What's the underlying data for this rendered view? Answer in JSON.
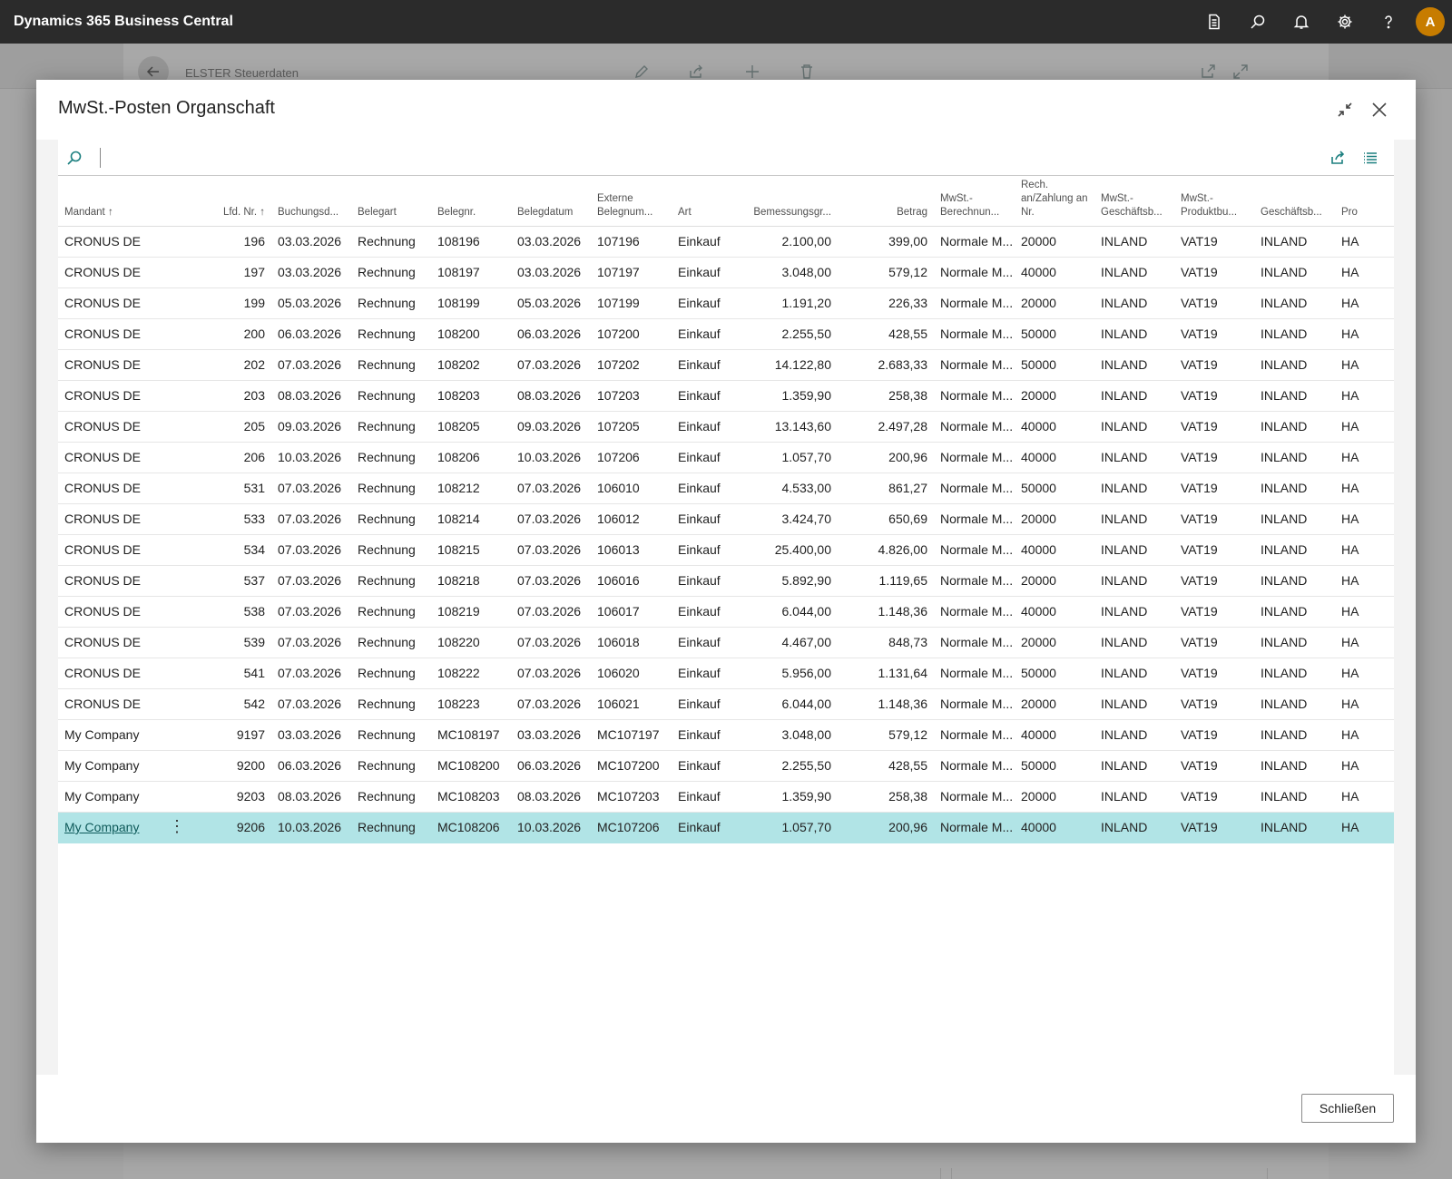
{
  "app": {
    "title": "Dynamics 365 Business Central",
    "avatar_initial": "A",
    "toolbar_icons": [
      "document-icon",
      "search-icon",
      "bell-icon",
      "gear-icon",
      "help-icon"
    ]
  },
  "background_page": {
    "title": "ELSTER Steuerdaten"
  },
  "dialog": {
    "title": "MwSt.-Posten Organschaft",
    "close_label": "Schließen",
    "columns": [
      {
        "key": "mandant",
        "label": "Mandant ↑"
      },
      {
        "key": "lfd",
        "label": "Lfd. Nr. ↑"
      },
      {
        "key": "buchung",
        "label": "Buchungsd..."
      },
      {
        "key": "belegart",
        "label": "Belegart"
      },
      {
        "key": "belegnr",
        "label": "Belegnr."
      },
      {
        "key": "belegdatum",
        "label": "Belegdatum"
      },
      {
        "key": "extern",
        "label": "Externe Belegnum..."
      },
      {
        "key": "art",
        "label": "Art"
      },
      {
        "key": "bemessung",
        "label": "Bemessungsgr..."
      },
      {
        "key": "betrag",
        "label": "Betrag"
      },
      {
        "key": "berechnung",
        "label": "MwSt.- Berechnun..."
      },
      {
        "key": "rech",
        "label": "Rech. an/Zahlung an Nr."
      },
      {
        "key": "geschaefts",
        "label": "MwSt.- Geschäftsb..."
      },
      {
        "key": "produkt",
        "label": "MwSt.- Produktbu..."
      },
      {
        "key": "gesch2",
        "label": "Geschäftsb..."
      },
      {
        "key": "prod2",
        "label": "Pro"
      }
    ],
    "rows": [
      [
        "CRONUS DE",
        "196",
        "03.03.2026",
        "Rechnung",
        "108196",
        "03.03.2026",
        "107196",
        "Einkauf",
        "2.100,00",
        "399,00",
        "Normale M...",
        "20000",
        "INLAND",
        "VAT19",
        "INLAND",
        "HA"
      ],
      [
        "CRONUS DE",
        "197",
        "03.03.2026",
        "Rechnung",
        "108197",
        "03.03.2026",
        "107197",
        "Einkauf",
        "3.048,00",
        "579,12",
        "Normale M...",
        "40000",
        "INLAND",
        "VAT19",
        "INLAND",
        "HA"
      ],
      [
        "CRONUS DE",
        "199",
        "05.03.2026",
        "Rechnung",
        "108199",
        "05.03.2026",
        "107199",
        "Einkauf",
        "1.191,20",
        "226,33",
        "Normale M...",
        "20000",
        "INLAND",
        "VAT19",
        "INLAND",
        "HA"
      ],
      [
        "CRONUS DE",
        "200",
        "06.03.2026",
        "Rechnung",
        "108200",
        "06.03.2026",
        "107200",
        "Einkauf",
        "2.255,50",
        "428,55",
        "Normale M...",
        "50000",
        "INLAND",
        "VAT19",
        "INLAND",
        "HA"
      ],
      [
        "CRONUS DE",
        "202",
        "07.03.2026",
        "Rechnung",
        "108202",
        "07.03.2026",
        "107202",
        "Einkauf",
        "14.122,80",
        "2.683,33",
        "Normale M...",
        "50000",
        "INLAND",
        "VAT19",
        "INLAND",
        "HA"
      ],
      [
        "CRONUS DE",
        "203",
        "08.03.2026",
        "Rechnung",
        "108203",
        "08.03.2026",
        "107203",
        "Einkauf",
        "1.359,90",
        "258,38",
        "Normale M...",
        "20000",
        "INLAND",
        "VAT19",
        "INLAND",
        "HA"
      ],
      [
        "CRONUS DE",
        "205",
        "09.03.2026",
        "Rechnung",
        "108205",
        "09.03.2026",
        "107205",
        "Einkauf",
        "13.143,60",
        "2.497,28",
        "Normale M...",
        "40000",
        "INLAND",
        "VAT19",
        "INLAND",
        "HA"
      ],
      [
        "CRONUS DE",
        "206",
        "10.03.2026",
        "Rechnung",
        "108206",
        "10.03.2026",
        "107206",
        "Einkauf",
        "1.057,70",
        "200,96",
        "Normale M...",
        "40000",
        "INLAND",
        "VAT19",
        "INLAND",
        "HA"
      ],
      [
        "CRONUS DE",
        "531",
        "07.03.2026",
        "Rechnung",
        "108212",
        "07.03.2026",
        "106010",
        "Einkauf",
        "4.533,00",
        "861,27",
        "Normale M...",
        "50000",
        "INLAND",
        "VAT19",
        "INLAND",
        "HA"
      ],
      [
        "CRONUS DE",
        "533",
        "07.03.2026",
        "Rechnung",
        "108214",
        "07.03.2026",
        "106012",
        "Einkauf",
        "3.424,70",
        "650,69",
        "Normale M...",
        "20000",
        "INLAND",
        "VAT19",
        "INLAND",
        "HA"
      ],
      [
        "CRONUS DE",
        "534",
        "07.03.2026",
        "Rechnung",
        "108215",
        "07.03.2026",
        "106013",
        "Einkauf",
        "25.400,00",
        "4.826,00",
        "Normale M...",
        "40000",
        "INLAND",
        "VAT19",
        "INLAND",
        "HA"
      ],
      [
        "CRONUS DE",
        "537",
        "07.03.2026",
        "Rechnung",
        "108218",
        "07.03.2026",
        "106016",
        "Einkauf",
        "5.892,90",
        "1.119,65",
        "Normale M...",
        "20000",
        "INLAND",
        "VAT19",
        "INLAND",
        "HA"
      ],
      [
        "CRONUS DE",
        "538",
        "07.03.2026",
        "Rechnung",
        "108219",
        "07.03.2026",
        "106017",
        "Einkauf",
        "6.044,00",
        "1.148,36",
        "Normale M...",
        "40000",
        "INLAND",
        "VAT19",
        "INLAND",
        "HA"
      ],
      [
        "CRONUS DE",
        "539",
        "07.03.2026",
        "Rechnung",
        "108220",
        "07.03.2026",
        "106018",
        "Einkauf",
        "4.467,00",
        "848,73",
        "Normale M...",
        "20000",
        "INLAND",
        "VAT19",
        "INLAND",
        "HA"
      ],
      [
        "CRONUS DE",
        "541",
        "07.03.2026",
        "Rechnung",
        "108222",
        "07.03.2026",
        "106020",
        "Einkauf",
        "5.956,00",
        "1.131,64",
        "Normale M...",
        "50000",
        "INLAND",
        "VAT19",
        "INLAND",
        "HA"
      ],
      [
        "CRONUS DE",
        "542",
        "07.03.2026",
        "Rechnung",
        "108223",
        "07.03.2026",
        "106021",
        "Einkauf",
        "6.044,00",
        "1.148,36",
        "Normale M...",
        "20000",
        "INLAND",
        "VAT19",
        "INLAND",
        "HA"
      ],
      [
        "My Company",
        "9197",
        "03.03.2026",
        "Rechnung",
        "MC108197",
        "03.03.2026",
        "MC107197",
        "Einkauf",
        "3.048,00",
        "579,12",
        "Normale M...",
        "40000",
        "INLAND",
        "VAT19",
        "INLAND",
        "HA"
      ],
      [
        "My Company",
        "9200",
        "06.03.2026",
        "Rechnung",
        "MC108200",
        "06.03.2026",
        "MC107200",
        "Einkauf",
        "2.255,50",
        "428,55",
        "Normale M...",
        "50000",
        "INLAND",
        "VAT19",
        "INLAND",
        "HA"
      ],
      [
        "My Company",
        "9203",
        "08.03.2026",
        "Rechnung",
        "MC108203",
        "08.03.2026",
        "MC107203",
        "Einkauf",
        "1.359,90",
        "258,38",
        "Normale M...",
        "20000",
        "INLAND",
        "VAT19",
        "INLAND",
        "HA"
      ],
      [
        "My Company",
        "9206",
        "10.03.2026",
        "Rechnung",
        "MC108206",
        "10.03.2026",
        "MC107206",
        "Einkauf",
        "1.057,70",
        "200,96",
        "Normale M...",
        "40000",
        "INLAND",
        "VAT19",
        "INLAND",
        "HA"
      ]
    ],
    "selected_row": 19
  },
  "colors": {
    "appbar": "#2b2b2b",
    "accent": "#1b7f7f",
    "selected_row": "#b1e4e6",
    "avatar": "#c77c00"
  }
}
